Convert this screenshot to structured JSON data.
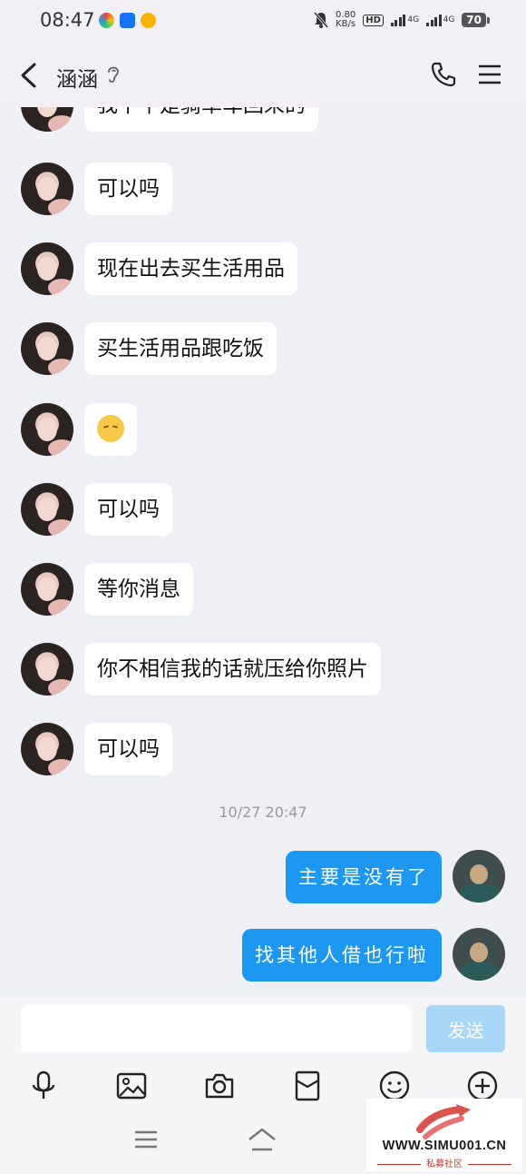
{
  "status_bar": {
    "time": "08:47",
    "app_icons": [
      {
        "name": "colorwheel-app-icon",
        "color": "#3cb371"
      },
      {
        "name": "zhihu-app-icon",
        "color": "#1772f6",
        "label": "知乎"
      },
      {
        "name": "baidu-app-icon",
        "color": "#f4b400"
      }
    ],
    "net_speed_value": "0.80",
    "net_speed_unit": "KB/s",
    "hd_label": "HD",
    "signal1_label": "4G",
    "signal2_label": "4G",
    "battery": "70"
  },
  "header": {
    "title": "涵涵"
  },
  "messages": [
    {
      "direction": "in",
      "text": "我下午是骑单车回来的"
    },
    {
      "direction": "in",
      "text": "可以吗"
    },
    {
      "direction": "in",
      "text": "现在出去买生活用品"
    },
    {
      "direction": "in",
      "text": "买生活用品跟吃饭"
    },
    {
      "direction": "in",
      "emoji": "pensive-face-emoji"
    },
    {
      "direction": "in",
      "text": "可以吗"
    },
    {
      "direction": "in",
      "text": "等你消息"
    },
    {
      "direction": "in",
      "text": "你不相信我的话就压给你照片"
    },
    {
      "direction": "in",
      "text": "可以吗"
    },
    {
      "direction": "out",
      "text": "主要是没有了"
    },
    {
      "direction": "out",
      "text": "找其他人借也行啦"
    }
  ],
  "timestamp": "10/27 20:47",
  "composer": {
    "input_value": "",
    "send_label": "发送"
  },
  "watermark": {
    "url": "WWW.SIMU001.CN",
    "subtitle": "私募社区"
  },
  "colors": {
    "outgoing_bubble": "#1d98f2",
    "send_button_disabled": "#a9d7f8",
    "background": "#efeff6"
  }
}
